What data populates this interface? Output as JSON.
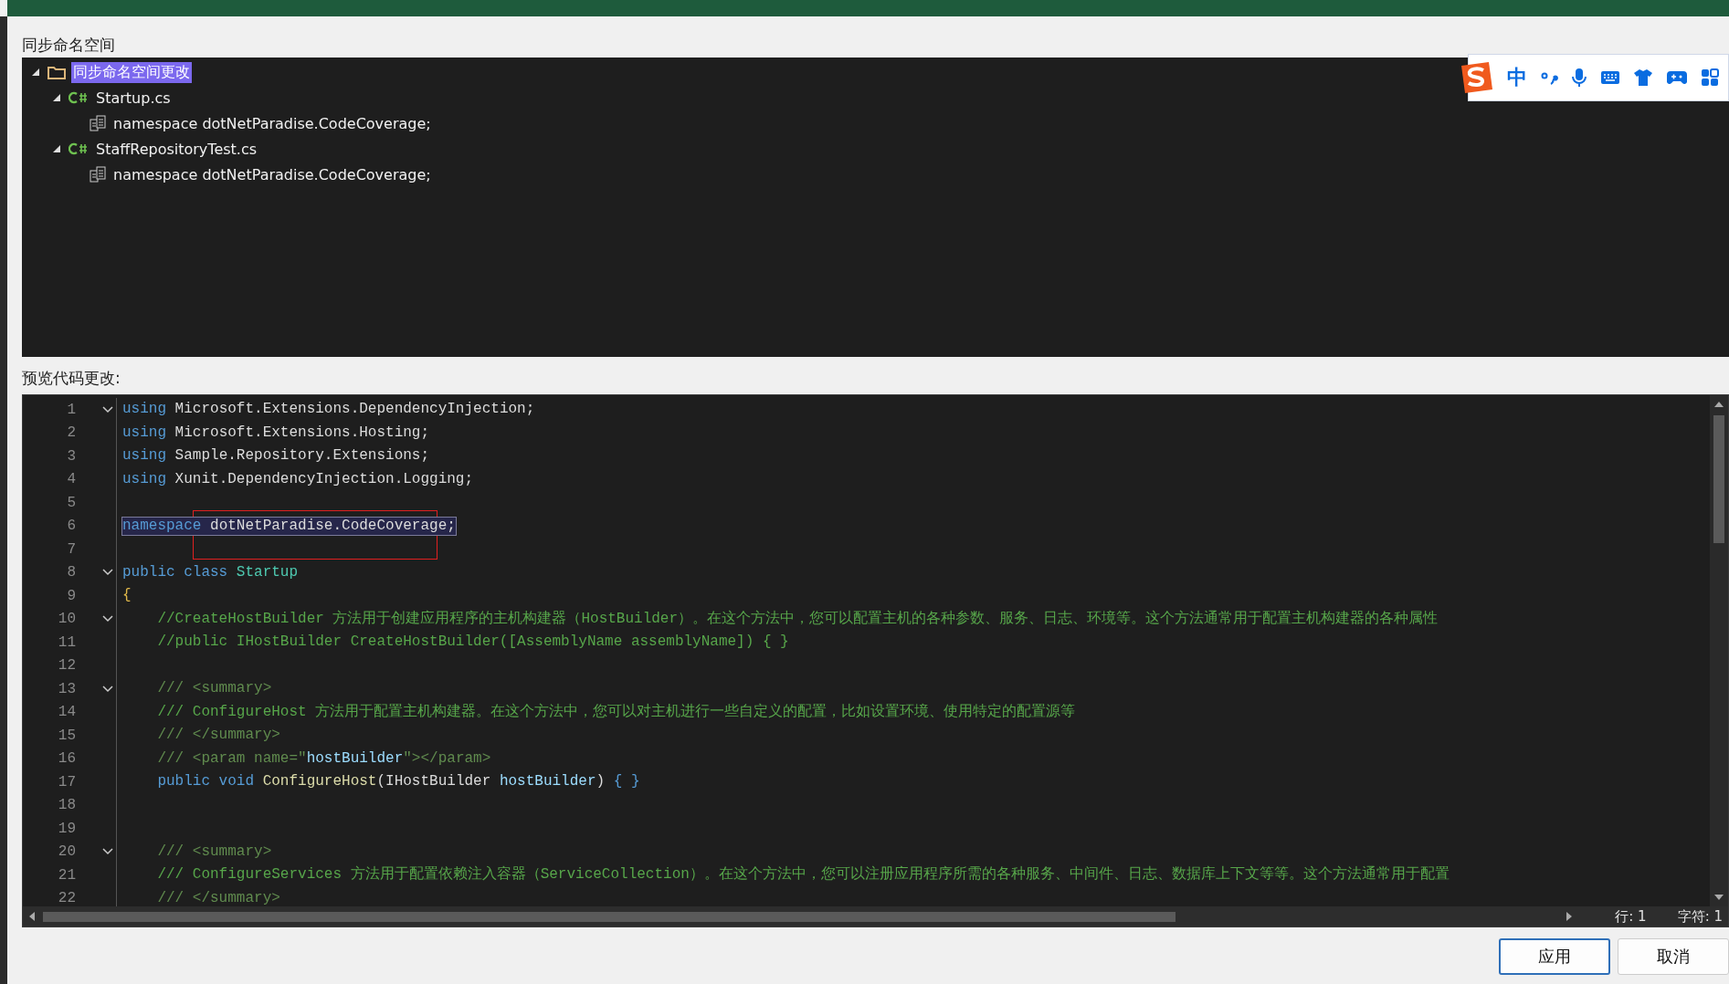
{
  "tree_section": {
    "label": "同步命名空间"
  },
  "tree": [
    {
      "kind": "root",
      "label": "同步命名空间更改",
      "expanded": true,
      "selected": true,
      "children": [
        {
          "kind": "file",
          "label": "Startup.cs",
          "expanded": true,
          "selected": false,
          "children": [
            {
              "kind": "change",
              "label": "namespace dotNetParadise.CodeCoverage;",
              "selected": false
            }
          ]
        },
        {
          "kind": "file",
          "label": "StaffRepositoryTest.cs",
          "expanded": true,
          "selected": false,
          "children": [
            {
              "kind": "change",
              "label": "namespace dotNetParadise.CodeCoverage;",
              "selected": false
            }
          ]
        }
      ]
    }
  ],
  "ime_toolbar": {
    "mode": "中"
  },
  "preview_section": {
    "label": "预览代码更改:"
  },
  "code": {
    "lines": [
      {
        "number": "1",
        "fold": true,
        "highlighted": false,
        "tokens": [
          {
            "kind": "keyword",
            "text": "using"
          },
          {
            "kind": "plain",
            "text": " Microsoft.Extensions.DependencyInjection;"
          }
        ]
      },
      {
        "number": "2",
        "fold": false,
        "highlighted": false,
        "tokens": [
          {
            "kind": "keyword",
            "text": "using"
          },
          {
            "kind": "plain",
            "text": " Microsoft.Extensions.Hosting;"
          }
        ]
      },
      {
        "number": "3",
        "fold": false,
        "highlighted": false,
        "tokens": [
          {
            "kind": "keyword",
            "text": "using"
          },
          {
            "kind": "plain",
            "text": " Sample.Repository.Extensions;"
          }
        ]
      },
      {
        "number": "4",
        "fold": false,
        "highlighted": false,
        "tokens": [
          {
            "kind": "keyword",
            "text": "using"
          },
          {
            "kind": "plain",
            "text": " Xunit.DependencyInjection.Logging;"
          }
        ]
      },
      {
        "number": "5",
        "fold": false,
        "highlighted": false
      },
      {
        "number": "6",
        "fold": false,
        "highlighted": true,
        "tokens": [
          {
            "kind": "keyword",
            "text": "namespace"
          },
          {
            "kind": "plain",
            "text": " dotNetParadise.CodeCoverage;"
          }
        ]
      },
      {
        "number": "7",
        "fold": false,
        "highlighted": false
      },
      {
        "number": "8",
        "fold": true,
        "highlighted": false,
        "tokens": [
          {
            "kind": "keyword",
            "text": "public class"
          },
          {
            "kind": "type",
            "text": " Startup"
          }
        ]
      },
      {
        "number": "9",
        "fold": false,
        "highlighted": false,
        "tokens": [
          {
            "kind": "brace",
            "text": "{"
          }
        ]
      },
      {
        "number": "10",
        "fold": true,
        "highlighted": false,
        "tokens": [
          {
            "kind": "comment",
            "text": "    //CreateHostBuilder 方法用于创建应用程序的主机构建器（HostBuilder）。在这个方法中，您可以配置主机的各种参数、服务、日志、环境等。这个方法通常用于配置主机构建器的各种属性"
          }
        ]
      },
      {
        "number": "11",
        "fold": false,
        "highlighted": false,
        "tokens": [
          {
            "kind": "comment",
            "text": "    //public IHostBuilder CreateHostBuilder([AssemblyName assemblyName]) { }"
          }
        ]
      },
      {
        "number": "12",
        "fold": false,
        "highlighted": false
      },
      {
        "number": "13",
        "fold": true,
        "highlighted": false,
        "tokens": [
          {
            "kind": "doc",
            "text": "    /// <summary>"
          }
        ]
      },
      {
        "number": "14",
        "fold": false,
        "highlighted": false,
        "tokens": [
          {
            "kind": "comment",
            "text": "    /// ConfigureHost 方法用于配置主机构建器。在这个方法中，您可以对主机进行一些自定义的配置，比如设置环境、使用特定的配置源等"
          }
        ]
      },
      {
        "number": "15",
        "fold": false,
        "highlighted": false,
        "tokens": [
          {
            "kind": "doc",
            "text": "    /// </summary>"
          }
        ]
      },
      {
        "number": "16",
        "fold": false,
        "highlighted": false,
        "tokens": [
          {
            "kind": "doc",
            "text": "    /// <param name=\""
          },
          {
            "kind": "param",
            "text": "hostBuilder"
          },
          {
            "kind": "doc",
            "text": "\"></param>"
          }
        ]
      },
      {
        "number": "17",
        "fold": false,
        "highlighted": false,
        "tokens": [
          {
            "kind": "keyword",
            "text": "    public void"
          },
          {
            "kind": "method",
            "text": " ConfigureHost"
          },
          {
            "kind": "plain",
            "text": "("
          },
          {
            "kind": "type2",
            "text": "IHostBuilder"
          },
          {
            "kind": "param",
            "text": " hostBuilder"
          },
          {
            "kind": "plain",
            "text": ")"
          },
          {
            "kind": "keyword",
            "text": " { }"
          }
        ]
      },
      {
        "number": "18",
        "fold": false,
        "highlighted": false
      },
      {
        "number": "19",
        "fold": false,
        "highlighted": false
      },
      {
        "number": "20",
        "fold": true,
        "highlighted": false,
        "tokens": [
          {
            "kind": "doc",
            "text": "    /// <summary>"
          }
        ]
      },
      {
        "number": "21",
        "fold": false,
        "highlighted": false,
        "tokens": [
          {
            "kind": "comment",
            "text": "    /// ConfigureServices 方法用于配置依赖注入容器（ServiceCollection）。在这个方法中，您可以注册应用程序所需的各种服务、中间件、日志、数据库上下文等等。这个方法通常用于配置"
          }
        ]
      },
      {
        "number": "22",
        "fold": false,
        "highlighted": false,
        "tokens": [
          {
            "kind": "doc",
            "text": "    /// </summary>"
          }
        ]
      }
    ]
  },
  "status": {
    "line": "行: 1",
    "char": "字符: 1"
  },
  "buttons": [
    {
      "kind": "primary",
      "label": "应用"
    },
    {
      "kind": "secondary",
      "label": "取消"
    }
  ]
}
